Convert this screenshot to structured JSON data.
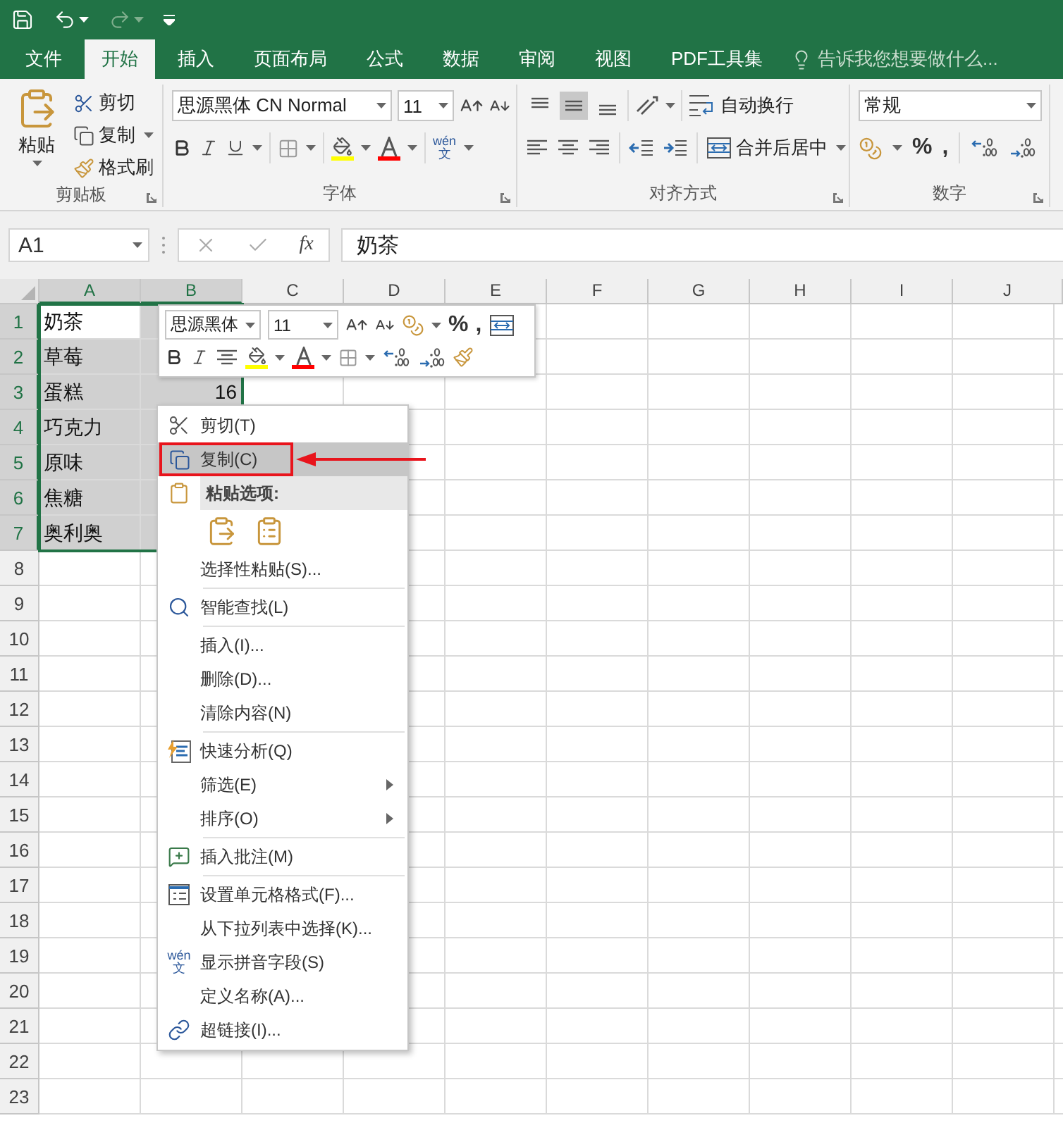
{
  "tabs": [
    {
      "label": "文件",
      "selected": false
    },
    {
      "label": "开始",
      "selected": true
    },
    {
      "label": "插入",
      "selected": false
    },
    {
      "label": "页面布局",
      "selected": false
    },
    {
      "label": "公式",
      "selected": false
    },
    {
      "label": "数据",
      "selected": false
    },
    {
      "label": "审阅",
      "selected": false
    },
    {
      "label": "视图",
      "selected": false
    },
    {
      "label": "PDF工具集",
      "selected": false
    }
  ],
  "tell_me": {
    "placeholder": "告诉我您想要做什么..."
  },
  "ribbon": {
    "clipboard": {
      "label": "剪贴板",
      "paste": "粘贴",
      "cut": "剪切",
      "copy": "复制",
      "format_painter": "格式刷"
    },
    "font": {
      "label": "字体",
      "font_name": "思源黑体 CN Normal",
      "font_size": "11",
      "phonetic": {
        "pinyin": "wén",
        "hanzi": "文"
      }
    },
    "alignment": {
      "label": "对齐方式",
      "vertical": [
        {
          "selected": false
        },
        {
          "selected": true
        },
        {
          "selected": false
        }
      ],
      "wrap_text": "自动换行",
      "merge_center": "合并后居中"
    },
    "number": {
      "label": "数字",
      "format": "常规",
      "percent": "%",
      "comma": ","
    }
  },
  "formula_bar": {
    "name_box": "A1",
    "fx": "fx",
    "value": "奶茶"
  },
  "sheet": {
    "columns": [
      "A",
      "B",
      "C",
      "D",
      "E",
      "F",
      "G",
      "H",
      "I",
      "J"
    ],
    "rows": [
      {
        "header": "1",
        "cells": [
          {
            "kind": "text",
            "text": "奶茶",
            "selected": true,
            "active": true
          },
          {
            "kind": "empty",
            "selected": true,
            "active": false
          }
        ]
      },
      {
        "header": "2",
        "cells": [
          {
            "kind": "text",
            "text": "草莓",
            "selected": true,
            "active": false
          },
          {
            "kind": "empty",
            "selected": true,
            "active": false
          }
        ]
      },
      {
        "header": "3",
        "cells": [
          {
            "kind": "text",
            "text": "蛋糕",
            "selected": true,
            "active": false
          },
          {
            "kind": "number",
            "text": "16",
            "selected": true,
            "active": false
          }
        ]
      },
      {
        "header": "4",
        "cells": [
          {
            "kind": "text",
            "text": "巧克力",
            "selected": true,
            "active": false
          },
          {
            "kind": "empty",
            "selected": true,
            "active": false
          }
        ]
      },
      {
        "header": "5",
        "cells": [
          {
            "kind": "text",
            "text": "原味",
            "selected": true,
            "active": false
          },
          {
            "kind": "empty",
            "selected": true,
            "active": false
          }
        ]
      },
      {
        "header": "6",
        "cells": [
          {
            "kind": "text",
            "text": "焦糖",
            "selected": true,
            "active": false
          },
          {
            "kind": "empty",
            "selected": true,
            "active": false
          }
        ]
      },
      {
        "header": "7",
        "cells": [
          {
            "kind": "text",
            "text": "奥利奥",
            "selected": true,
            "active": false
          },
          {
            "kind": "empty",
            "selected": true,
            "active": false
          }
        ]
      },
      {
        "header": "8"
      },
      {
        "header": "9"
      },
      {
        "header": "10"
      },
      {
        "header": "11"
      },
      {
        "header": "12"
      },
      {
        "header": "13"
      },
      {
        "header": "14"
      },
      {
        "header": "15"
      },
      {
        "header": "16"
      },
      {
        "header": "17"
      },
      {
        "header": "18"
      },
      {
        "header": "19"
      },
      {
        "header": "20"
      },
      {
        "header": "21"
      },
      {
        "header": "22"
      },
      {
        "header": "23"
      }
    ]
  },
  "mini_toolbar": {
    "font_name": "思源黑体",
    "font_size": "11",
    "percent": "%",
    "comma": ","
  },
  "context_menu": {
    "groups": [
      [
        {
          "kind": "item",
          "label": "剪切(T)",
          "selected": false,
          "submenu": false
        },
        {
          "kind": "item",
          "label": "复制(C)",
          "selected": true,
          "submenu": false
        },
        {
          "kind": "header",
          "label": "粘贴选项:"
        },
        {
          "kind": "paste_options"
        },
        {
          "kind": "item",
          "label": "选择性粘贴(S)...",
          "selected": false,
          "submenu": false
        }
      ],
      [
        {
          "kind": "item",
          "label": "智能查找(L)",
          "selected": false,
          "submenu": false
        }
      ],
      [
        {
          "kind": "item",
          "label": "插入(I)...",
          "selected": false,
          "submenu": false
        },
        {
          "kind": "item",
          "label": "删除(D)...",
          "selected": false,
          "submenu": false
        },
        {
          "kind": "item",
          "label": "清除内容(N)",
          "selected": false,
          "submenu": false
        }
      ],
      [
        {
          "kind": "item",
          "label": "快速分析(Q)",
          "selected": false,
          "submenu": false
        },
        {
          "kind": "item",
          "label": "筛选(E)",
          "selected": false,
          "submenu": true
        },
        {
          "kind": "item",
          "label": "排序(O)",
          "selected": false,
          "submenu": true
        }
      ],
      [
        {
          "kind": "item",
          "label": "插入批注(M)",
          "selected": false,
          "submenu": false
        }
      ],
      [
        {
          "kind": "item",
          "label": "设置单元格格式(F)...",
          "selected": false,
          "submenu": false
        },
        {
          "kind": "item",
          "label": "从下拉列表中选择(K)...",
          "selected": false,
          "submenu": false
        },
        {
          "kind": "item",
          "label": "显示拼音字段(S)",
          "selected": false,
          "submenu": false,
          "pinyin": "wén",
          "hanzi": "文"
        },
        {
          "kind": "item",
          "label": "定义名称(A)...",
          "selected": false,
          "submenu": false
        },
        {
          "kind": "item",
          "label": "超链接(I)...",
          "selected": false,
          "submenu": false
        }
      ]
    ]
  }
}
